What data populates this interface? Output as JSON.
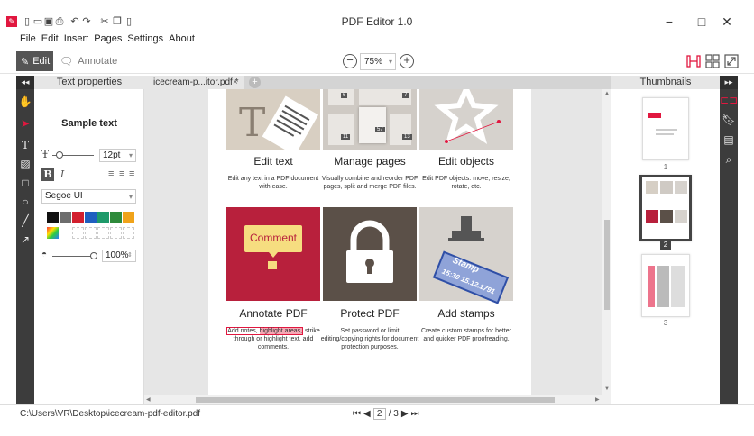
{
  "window": {
    "title": "PDF Editor 1.0",
    "controls": {
      "minimize": "−",
      "maximize": "□",
      "close": "✕"
    }
  },
  "quick_access": {
    "icons": [
      "app-logo-icon",
      "new-file-icon",
      "open-folder-icon",
      "save-icon",
      "print-icon",
      "undo-icon",
      "redo-icon",
      "cut-icon",
      "copy-icon",
      "paste-icon"
    ]
  },
  "menu": [
    "File",
    "Edit",
    "Insert",
    "Pages",
    "Settings",
    "About"
  ],
  "toolbar": {
    "edit_label": "Edit",
    "annotate_label": "Annotate",
    "zoom_value": "75%",
    "view_icons": [
      "single-page-view-icon",
      "multi-page-view-icon",
      "fullscreen-icon"
    ]
  },
  "text_properties": {
    "header": "Text properties",
    "sample": "Sample text",
    "font_size": "12pt",
    "font_family": "Segoe UI",
    "opacity": "100%",
    "colors": [
      "#111111",
      "#6d6d6d",
      "#d21f2e",
      "#1f5fbf",
      "#1e9a6a",
      "#2e8a3b",
      "#f0a31a"
    ]
  },
  "tabs": [
    {
      "label": "icecream-p...itor.pdf *",
      "close": "×"
    }
  ],
  "document": {
    "features": [
      {
        "title": "Edit text",
        "desc": "Edit any text in a PDF document with ease."
      },
      {
        "title": "Manage pages",
        "desc": "Visually combine and reorder PDF pages, split and merge PDF files."
      },
      {
        "title": "Edit objects",
        "desc": "Edit PDF objects: move, resize, rotate, etc."
      },
      {
        "title": "Annotate PDF",
        "desc_before": "Add notes, ",
        "desc_highlight": "highlight areas,",
        "desc_after": " strike through or highlight text, add comments."
      },
      {
        "title": "Protect PDF",
        "desc": "Set password or limit editing/copying rights for document protection purposes."
      },
      {
        "title": "Add stamps",
        "desc": "Create custom stamps for better and quicker PDF proofreading."
      }
    ],
    "comment_label": "Comment",
    "stamp_label": "Stamp",
    "stamp_date": "15:30 15.12.1791",
    "page_numbers": [
      "6",
      "7",
      "11",
      "57",
      "13"
    ]
  },
  "thumbnails": {
    "header": "Thumbnails",
    "pages": [
      "1",
      "2",
      "3"
    ],
    "selected": "2"
  },
  "status": {
    "path": "C:\\Users\\VR\\Desktop\\icecream-pdf-editor.pdf",
    "current_page": "2",
    "total": "/ 3"
  },
  "colors": {
    "accent": "#e1173f",
    "dark_panel": "#3c3c3c"
  }
}
